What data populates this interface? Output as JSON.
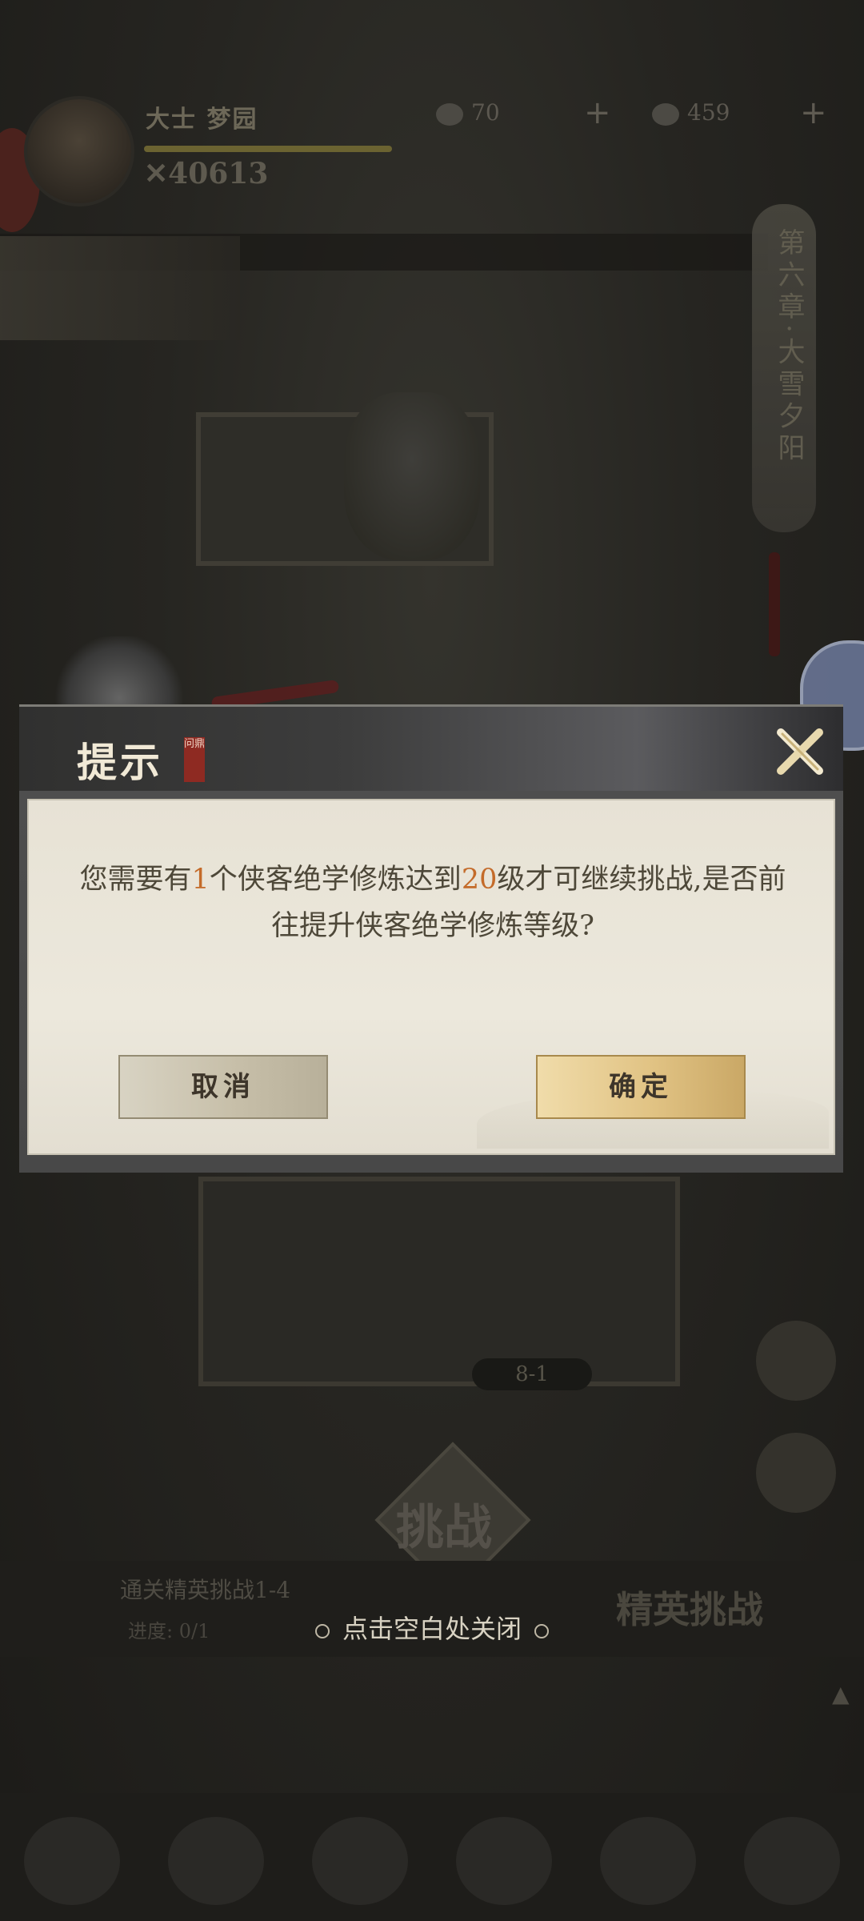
{
  "background": {
    "player_name": "大士 梦园",
    "power": "✕40613",
    "gem_count": "70",
    "gold_count": "459",
    "chapter_title": "第六章·大雪夕阳",
    "stage_label": "8-1",
    "challenge_label": "挑战",
    "task_title": "通关精英挑战1-4",
    "task_progress": "进度: 0/1",
    "elite_label": "精英挑战"
  },
  "dialog": {
    "title": "提示",
    "stamp_text": "问鼎",
    "message": {
      "part1": "您需要有",
      "count": "1",
      "part2": "个侠客绝学修炼达到",
      "level": "20",
      "part3": "级才可继续挑战,是否前往提升侠客绝学修炼等级?"
    },
    "cancel_label": "取消",
    "confirm_label": "确定"
  },
  "hint": {
    "tap_to_close": "点击空白处关闭"
  },
  "colors": {
    "highlight": "#c46b2a",
    "dialog_paper": "#ece8dc",
    "confirm_gold": "#e1c384"
  }
}
